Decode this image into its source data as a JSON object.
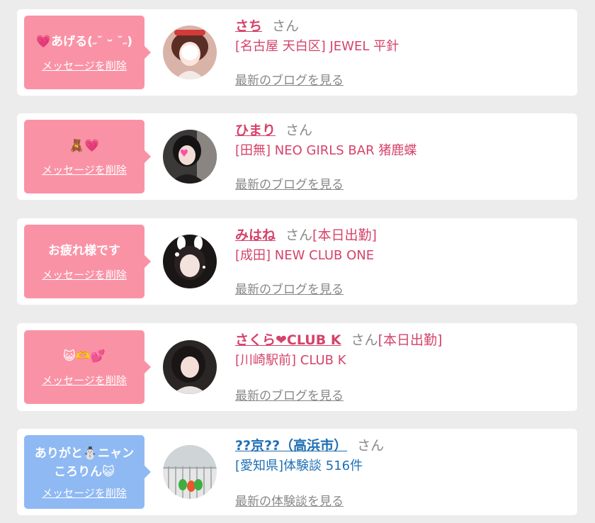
{
  "entries": [
    {
      "message": "💗あげる(˶˘ ᵕ ˘˶)",
      "delete_label": "メッセージを削除",
      "name": "さち",
      "honorific": "さん",
      "tag": "",
      "shop": "[名古屋 天白区] JEWEL 平針",
      "blog_link": "最新のブログを見る"
    },
    {
      "message": "🧸💗",
      "delete_label": "メッセージを削除",
      "name": "ひまり",
      "honorific": "さん",
      "tag": "",
      "shop": "[田無] NEO GIRLS BAR 猪鹿蝶",
      "blog_link": "最新のブログを見る"
    },
    {
      "message": "お疲れ様です",
      "delete_label": "メッセージを削除",
      "name": "みはね",
      "honorific": "さん",
      "tag": "[本日出勤]",
      "shop": "[成田] NEW CLUB ONE",
      "blog_link": "最新のブログを見る"
    },
    {
      "message": "😺🫶💕",
      "delete_label": "メッセージを削除",
      "name": "さくら❤CLUB K",
      "honorific": "さん",
      "tag": "[本日出勤]",
      "shop": "[川崎駅前] CLUB K",
      "blog_link": "最新のブログを見る"
    },
    {
      "message": "ありがと☃️ニャン\nころりん😺",
      "delete_label": "メッセージを削除",
      "name": "??京??（高浜市）",
      "honorific": "さん",
      "tag": "",
      "shop": "[愛知県]体験談 516件",
      "blog_link": "最新の体験談を見る"
    }
  ],
  "colors": {
    "pink_bubble": "#fa92a6",
    "blue_bubble": "#8fb9f3",
    "name_pink": "#d5436a",
    "name_blue": "#1e6fb3",
    "background": "#ececec"
  }
}
